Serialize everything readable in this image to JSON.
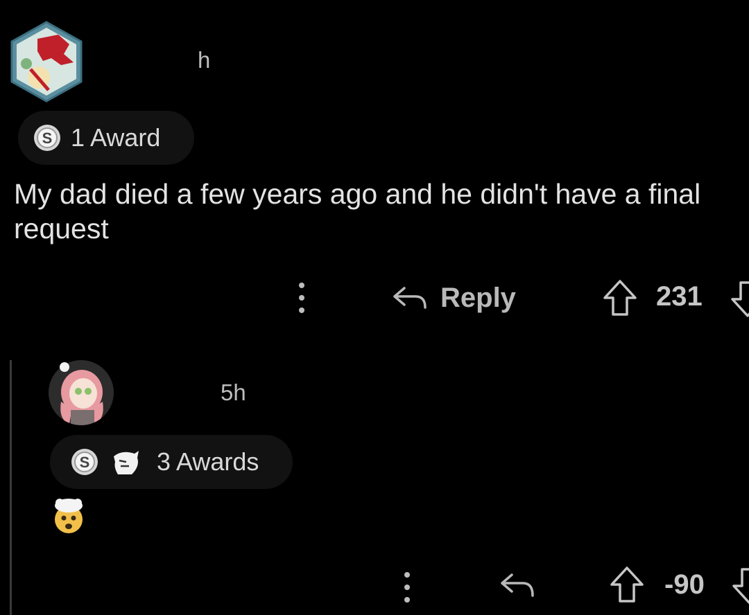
{
  "comment": {
    "time": "h",
    "awards_label": "1 Award",
    "body": "My dad died a few years ago and he didn't have a final request",
    "reply_label": "Reply",
    "score": "231"
  },
  "reply": {
    "time": "5h",
    "awards_label": "3 Awards",
    "body_emoji": "🤯",
    "score": "-90"
  },
  "icons": {
    "avatar1": "hexagon-avatar-icon",
    "avatar2": "anime-avatar-icon",
    "award_coin": "silver-award-icon",
    "award_second": "wholesome-award-icon",
    "reply": "reply-arrow-icon",
    "upvote": "upvote-arrow-icon",
    "downvote": "downvote-arrow-icon",
    "more": "more-vertical-icon"
  },
  "colors": {
    "background": "#000000",
    "text": "#e3e3e3",
    "muted": "#bdbdbd",
    "pill": "#121212"
  }
}
